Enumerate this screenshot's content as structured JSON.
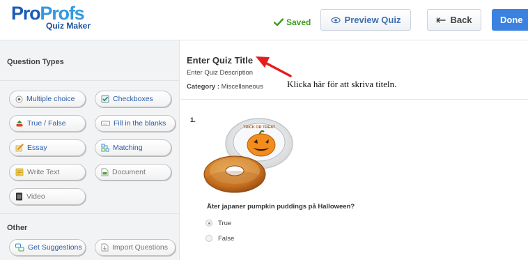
{
  "header": {
    "logo": {
      "main_part1": "Pro",
      "main_part2": "Profs",
      "sub": "Quiz Maker"
    },
    "saved_label": "Saved",
    "preview_label": "Preview Quiz",
    "back_label": "Back",
    "done_label": "Done"
  },
  "sidebar": {
    "question_types_heading": "Question Types",
    "question_types": [
      {
        "label": "Multiple choice",
        "icon": "radio-icon"
      },
      {
        "label": "Checkboxes",
        "icon": "checkbox-icon"
      },
      {
        "label": "True / False",
        "icon": "thumbs-icon"
      },
      {
        "label": "Fill in the blanks",
        "icon": "blank-field-icon"
      },
      {
        "label": "Essay",
        "icon": "pencil-icon"
      },
      {
        "label": "Matching",
        "icon": "matching-icon"
      },
      {
        "label": "Write Text",
        "icon": "note-icon"
      },
      {
        "label": "Document",
        "icon": "document-icon"
      },
      {
        "label": "Video",
        "icon": "film-icon"
      }
    ],
    "other_heading": "Other",
    "other": [
      {
        "label": "Get Suggestions",
        "icon": "suggestions-icon"
      },
      {
        "label": "Import Questions",
        "icon": "import-icon"
      }
    ]
  },
  "quiz": {
    "title": "Enter Quiz Title",
    "description": "Enter Quiz Description",
    "category_label": "Category :",
    "category_value": "Miscellaneous",
    "annotation": "Klicka här för att skriva titeln.",
    "question": {
      "number": "1.",
      "image_text": "TRICK OR TREAT",
      "text": "Äter japaner pumpkin puddings på Halloween?",
      "options": [
        {
          "label": "True",
          "selected": true
        },
        {
          "label": "False",
          "selected": false
        }
      ]
    }
  },
  "colors": {
    "brand_blue": "#1a5bb8",
    "brand_light_blue": "#3399e0",
    "saved_green": "#3d9a1e",
    "done_blue": "#3b82e0",
    "annotation_red": "#e41e1e"
  }
}
